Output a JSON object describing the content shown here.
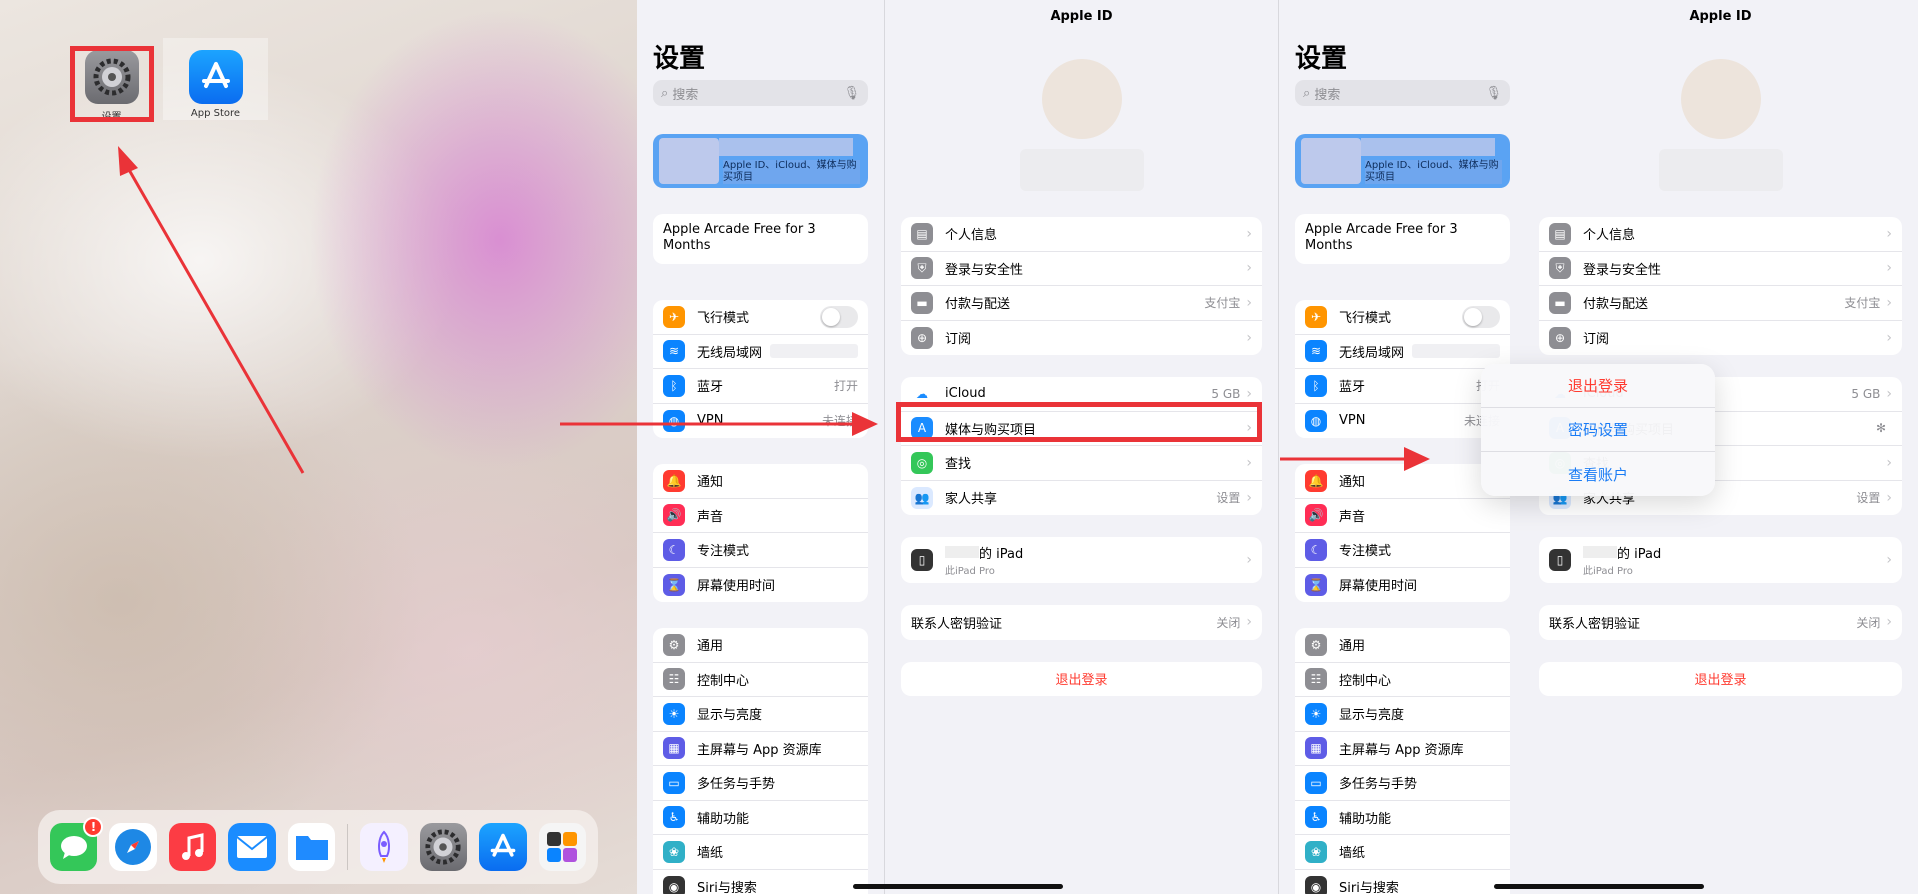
{
  "home": {
    "icons": [
      {
        "label": "设置",
        "icon": "settings-gear-icon"
      },
      {
        "label": "App Store",
        "icon": "app-store-icon"
      }
    ],
    "dock": [
      {
        "icon": "messages-icon",
        "color": "#34c759",
        "badge": "!"
      },
      {
        "icon": "safari-icon",
        "color": "#1e88e5"
      },
      {
        "icon": "music-icon",
        "color": "#fc3c44"
      },
      {
        "icon": "mail-icon",
        "color": "#1a8cff"
      },
      {
        "icon": "files-icon",
        "color": "#1f8bff"
      },
      {
        "icon": "rocket-icon",
        "color": "#f4f0ff"
      },
      {
        "icon": "settings-gear-icon",
        "color": "#6b6b70"
      },
      {
        "icon": "app-store-icon",
        "color": "#0a6cf0"
      },
      {
        "icon": "app-library-icon",
        "color": "#f5f5f5"
      }
    ]
  },
  "settings_sidebar": {
    "title": "设置",
    "search_placeholder": "搜索",
    "apple_id_text": "Apple ID、iCloud、媒体与购买项目",
    "arcade": "Apple Arcade Free for 3 Months",
    "connectivity": [
      {
        "label": "飞行模式",
        "icon": "airplane-icon",
        "color": "#ff9500",
        "value": ""
      },
      {
        "label": "无线局域网",
        "icon": "wifi-icon",
        "color": "#0a84ff",
        "value": ""
      },
      {
        "label": "蓝牙",
        "icon": "bluetooth-icon",
        "color": "#0a84ff",
        "value": "打开"
      },
      {
        "label": "VPN",
        "icon": "vpn-icon",
        "color": "#0a84ff",
        "value": "未连接"
      }
    ],
    "notifications": [
      {
        "label": "通知",
        "icon": "bell-icon",
        "color": "#ff3b30"
      },
      {
        "label": "声音",
        "icon": "speaker-icon",
        "color": "#ff2d55"
      },
      {
        "label": "专注模式",
        "icon": "moon-icon",
        "color": "#5e5ce6"
      },
      {
        "label": "屏幕使用时间",
        "icon": "hourglass-icon",
        "color": "#5e5ce6"
      }
    ],
    "general": [
      {
        "label": "通用",
        "icon": "gear-icon",
        "color": "#8e8e93"
      },
      {
        "label": "控制中心",
        "icon": "switches-icon",
        "color": "#8e8e93"
      },
      {
        "label": "显示与亮度",
        "icon": "sun-icon",
        "color": "#0a84ff"
      },
      {
        "label": "主屏幕与 App 资源库",
        "icon": "grid-icon",
        "color": "#5e5ce6"
      },
      {
        "label": "多任务与手势",
        "icon": "multitask-icon",
        "color": "#0a84ff"
      },
      {
        "label": "辅助功能",
        "icon": "accessibility-icon",
        "color": "#0a84ff"
      },
      {
        "label": "墙纸",
        "icon": "flower-icon",
        "color": "#30b0c7"
      },
      {
        "label": "Siri与搜索",
        "icon": "siri-icon",
        "color": "#333333"
      }
    ]
  },
  "apple_id": {
    "title": "Apple ID",
    "account": [
      {
        "label": "个人信息",
        "icon": "id-card-icon",
        "value": ""
      },
      {
        "label": "登录与安全性",
        "icon": "shield-icon",
        "value": ""
      },
      {
        "label": "付款与配送",
        "icon": "credit-card-icon",
        "value": "支付宝"
      },
      {
        "label": "订阅",
        "icon": "subscription-icon",
        "value": ""
      }
    ],
    "services": [
      {
        "label": "iCloud",
        "icon": "cloud-icon",
        "value": "5 GB"
      },
      {
        "label": "媒体与购买项目",
        "icon": "app-store-icon",
        "value": ""
      },
      {
        "label": "查找",
        "icon": "find-my-icon",
        "value": ""
      },
      {
        "label": "家人共享",
        "icon": "family-icon",
        "value": "设置"
      }
    ],
    "device_name": "的 iPad",
    "device_sub": "此iPad Pro",
    "contact_key": "联系人密钥验证",
    "contact_key_value": "关闭",
    "logout": "退出登录"
  },
  "popup": {
    "items": [
      "退出登录",
      "密码设置",
      "查看账户"
    ]
  },
  "colors": {
    "highlight": "#ea3338",
    "link": "#1a7cf5",
    "danger": "#ff3b30"
  }
}
